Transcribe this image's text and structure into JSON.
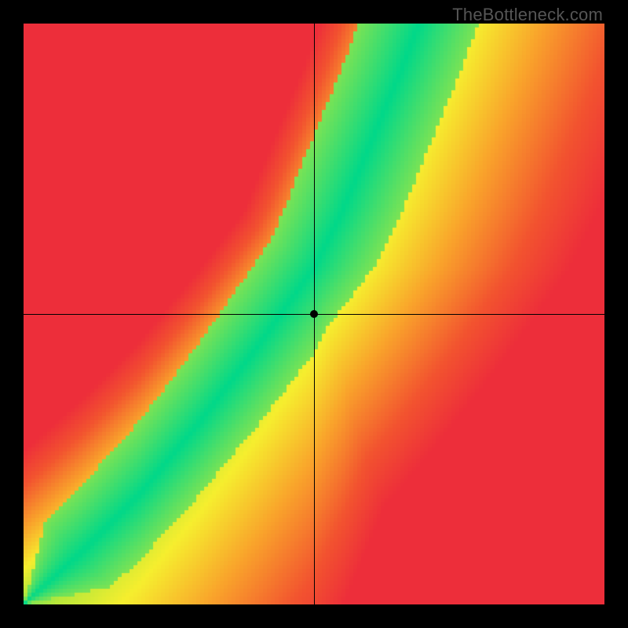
{
  "watermark": "TheBottleneck.com",
  "chart_data": {
    "type": "heatmap",
    "title": "",
    "xlabel": "",
    "ylabel": "",
    "xlim": [
      0,
      100
    ],
    "ylim": [
      0,
      100
    ],
    "crosshair": {
      "x": 50,
      "y": 50
    },
    "point": {
      "x": 50,
      "y": 50
    },
    "description": "Color value at each (x,y) encodes distance from a diagonal 'optimal balance' ridge. Green along the ridge, fading through yellow/orange to red further away. The ridge runs roughly from bottom-left toward upper-center with a mild S-curve.",
    "ridge_samples": [
      {
        "x": 0,
        "y": 0
      },
      {
        "x": 10,
        "y": 9
      },
      {
        "x": 20,
        "y": 19
      },
      {
        "x": 30,
        "y": 31
      },
      {
        "x": 40,
        "y": 44
      },
      {
        "x": 50,
        "y": 58
      },
      {
        "x": 55,
        "y": 68
      },
      {
        "x": 60,
        "y": 80
      },
      {
        "x": 65,
        "y": 92
      },
      {
        "x": 68,
        "y": 100
      }
    ],
    "color_stops": [
      {
        "t": 0.0,
        "color": "#00d889"
      },
      {
        "t": 0.18,
        "color": "#b8e83a"
      },
      {
        "t": 0.32,
        "color": "#f6ee2e"
      },
      {
        "t": 0.55,
        "color": "#f9a22b"
      },
      {
        "t": 0.8,
        "color": "#f2532f"
      },
      {
        "t": 1.0,
        "color": "#ed2e3a"
      }
    ],
    "pixelation": 5
  }
}
